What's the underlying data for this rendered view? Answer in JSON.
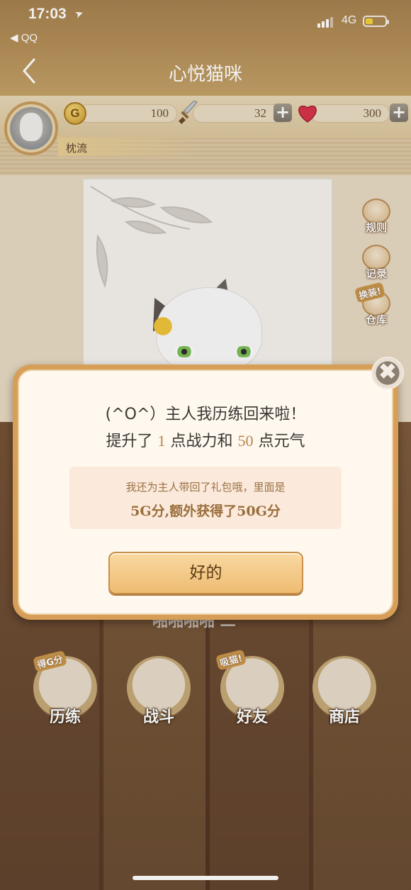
{
  "status": {
    "time": "17:03",
    "back_app": "◀ QQ",
    "network": "4G",
    "battery_level": 0.4
  },
  "nav": {
    "title": "心悦猫咪"
  },
  "player": {
    "name": "枕流",
    "coins": "100",
    "power": "32",
    "hearts": "300"
  },
  "side_menu": [
    {
      "label": "规则",
      "icon": "question-icon"
    },
    {
      "label": "记录",
      "icon": "book-icon"
    },
    {
      "label": "仓库",
      "icon": "warehouse-icon",
      "badge": "换装!"
    }
  ],
  "bottom_nav": [
    {
      "label": "历练",
      "icon": "scroll-gold-icon",
      "badge": "得G分"
    },
    {
      "label": "战斗",
      "icon": "swords-icon"
    },
    {
      "label": "好友",
      "icon": "cat-drink-icon",
      "badge": "吸猫!"
    },
    {
      "label": "商店",
      "icon": "maid-dress-icon"
    }
  ],
  "dialog": {
    "line1": "(^O^）主人我历练回来啦！",
    "line2_prefix": "提升了",
    "line2_power": "1",
    "line2_mid": "点战力和",
    "line2_vigor": "50",
    "line2_suffix": "点元气",
    "gift_text": "我还为主人带回了礼包哦，里面是",
    "gift_reward": "5G分,额外获得了50G分",
    "ok_label": "好的",
    "close_symbol": "✖"
  },
  "background_partial_text": "啪啪啪啪 二",
  "colors": {
    "accent_gold": "#d79e58",
    "dialog_bg": "#fff8ef",
    "button_gold": "#eebc72"
  }
}
